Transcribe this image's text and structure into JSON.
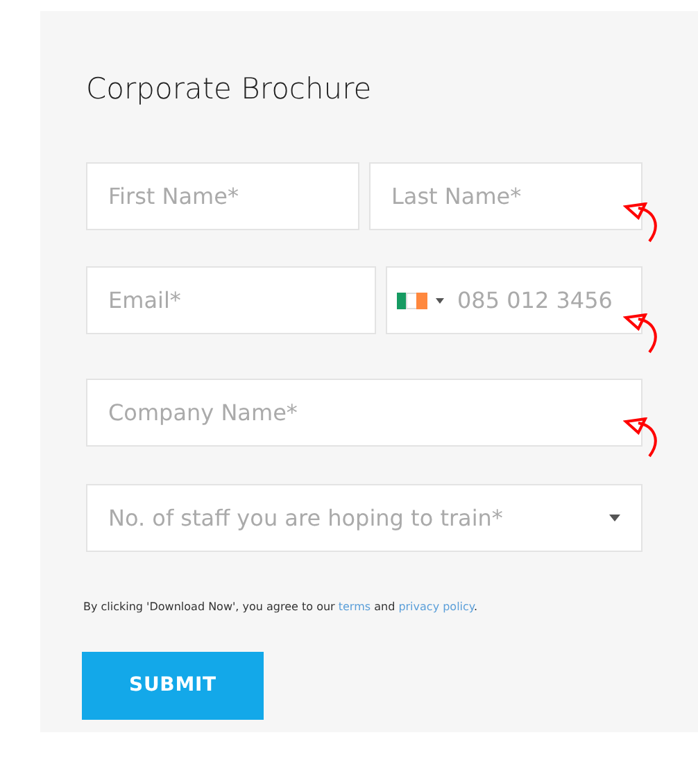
{
  "title": "Corporate Brochure",
  "rows": [
    [
      {
        "kind": "text",
        "placeholder": "First Name*"
      },
      {
        "kind": "text",
        "placeholder": "Last Name*"
      }
    ],
    [
      {
        "kind": "text",
        "placeholder": "Email*"
      },
      {
        "kind": "phone",
        "placeholder": "085 012 3456"
      }
    ],
    [
      {
        "kind": "text",
        "placeholder": "Company Name*"
      }
    ],
    [
      {
        "kind": "select",
        "placeholder": "No. of staff you are hoping to train*"
      }
    ]
  ],
  "consent": [
    {
      "kind": "text",
      "text": "By clicking 'Download Now', you agree to our "
    },
    {
      "kind": "link",
      "text": "terms"
    },
    {
      "kind": "text",
      "text": " and "
    },
    {
      "kind": "link",
      "text": "privacy policy"
    },
    {
      "kind": "text",
      "text": "."
    }
  ],
  "submit": "SUBMIT"
}
